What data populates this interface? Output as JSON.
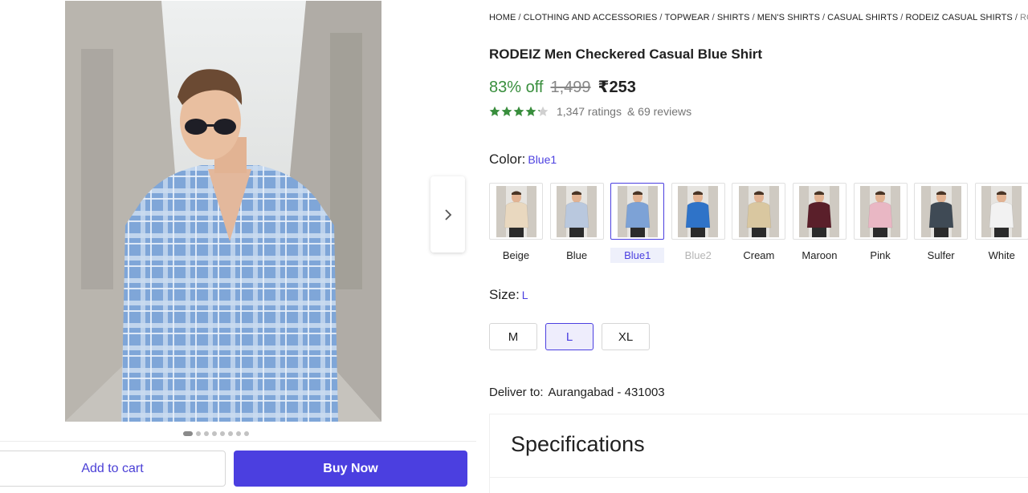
{
  "gallery": {
    "image_alt": "Man wearing blue checkered casual shirt and sunglasses in a concrete alley",
    "dot_count": 8,
    "active_dot": 0
  },
  "actions": {
    "add_to_cart": "Add to cart",
    "buy_now": "Buy Now"
  },
  "breadcrumb": [
    "HOME",
    "CLOTHING AND ACCESSORIES",
    "TOPWEAR",
    "SHIRTS",
    "MEN'S SHIRTS",
    "CASUAL SHIRTS",
    "RODEIZ CASUAL SHIRTS",
    "RODE"
  ],
  "product": {
    "title": "RODEIZ Men Checkered Casual Blue Shirt",
    "discount": "83% off",
    "mrp": "1,499",
    "price": "₹253",
    "rating_stars": 4.2,
    "ratings": "1,347 ratings",
    "reviews": "& 69 reviews"
  },
  "color": {
    "label": "Color:",
    "selected": "Blue1",
    "options": [
      {
        "name": "Beige",
        "shirt": "#e9d8bf",
        "state": "normal"
      },
      {
        "name": "Blue",
        "shirt": "#b9c8de",
        "state": "normal"
      },
      {
        "name": "Blue1",
        "shirt": "#7da2d6",
        "state": "selected"
      },
      {
        "name": "Blue2",
        "shirt": "#2f73c8",
        "state": "disabled"
      },
      {
        "name": "Cream",
        "shirt": "#d9c7a0",
        "state": "normal"
      },
      {
        "name": "Maroon",
        "shirt": "#5a1f2a",
        "state": "normal"
      },
      {
        "name": "Pink",
        "shirt": "#e9b7c4",
        "state": "normal"
      },
      {
        "name": "Sulfer",
        "shirt": "#3f4a55",
        "state": "normal"
      },
      {
        "name": "White",
        "shirt": "#f2f2f2",
        "state": "normal"
      }
    ]
  },
  "size": {
    "label": "Size:",
    "selected": "L",
    "options": [
      "M",
      "L",
      "XL"
    ]
  },
  "delivery": {
    "label": "Deliver to:",
    "location": "Aurangabad - 431003"
  },
  "specifications": {
    "heading": "Specifications"
  },
  "colors": {
    "accent": "#4b3fe0",
    "discount_green": "#388e3c",
    "star_green": "#388e3c"
  }
}
